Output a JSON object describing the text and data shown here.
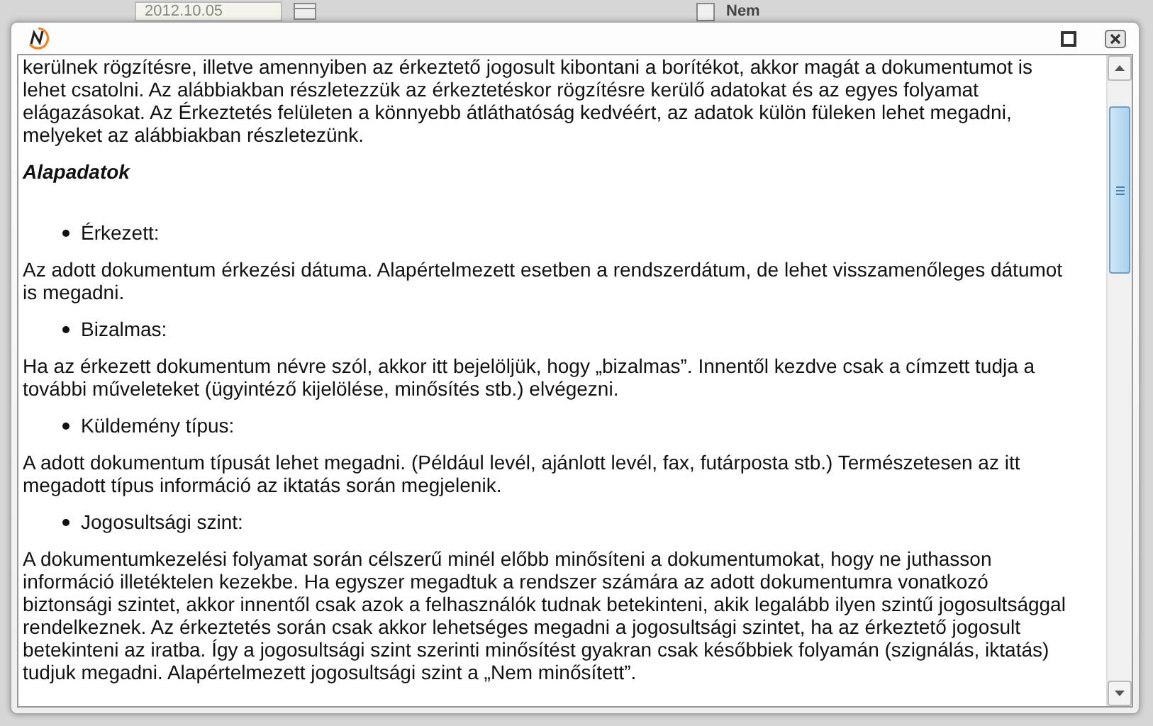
{
  "background": {
    "date_field": {
      "value": "2012.10.05"
    },
    "checkbox": {
      "label": "Nem",
      "checked": false
    }
  },
  "dialog": {
    "content": [
      {
        "kind": "paragraph",
        "text": "kerülnek rögzítésre, illetve amennyiben az érkeztető jogosult kibontani a borítékot, akkor magát a dokumentumot is lehet csatolni. Az alábbiakban részletezzük az érkeztetéskor rögzítésre kerülő adatokat és az egyes folyamat elágazásokat. Az Érkeztetés felületen a könnyebb átláthatóság kedvéért, az adatok külön füleken lehet megadni, melyeket az alábbiakban részletezünk."
      },
      {
        "kind": "heading",
        "text": "Alapadatok"
      },
      {
        "kind": "bullet",
        "text": "Érkezett:"
      },
      {
        "kind": "paragraph",
        "text": "Az adott dokumentum érkezési dátuma. Alapértelmezett esetben a rendszerdátum, de lehet visszamenőleges dátumot is megadni."
      },
      {
        "kind": "bullet",
        "text": "Bizalmas:"
      },
      {
        "kind": "paragraph",
        "text": "Ha az érkezett dokumentum névre szól, akkor itt bejelöljük, hogy „bizalmas”. Innentől kezdve csak a címzett tudja a további műveleteket (ügyintéző kijelölése, minősítés stb.) elvégezni."
      },
      {
        "kind": "bullet",
        "text": "Küldemény típus:"
      },
      {
        "kind": "paragraph",
        "text": "A adott dokumentum típusát lehet megadni. (Például levél, ajánlott levél, fax, futárposta stb.) Természetesen az itt megadott típus információ az iktatás során megjelenik."
      },
      {
        "kind": "bullet",
        "text": "Jogosultsági szint:"
      },
      {
        "kind": "paragraph",
        "text": "A dokumentumkezelési folyamat során célszerű minél előbb minősíteni a dokumentumokat, hogy ne juthasson információ illetéktelen kezekbe. Ha egyszer megadtuk a rendszer számára az adott dokumentumra vonatkozó biztonsági szintet, akkor innentől csak azok a felhasználók tudnak betekinteni, akik legalább ilyen szintű jogosultsággal rendelkeznek. Az érkeztetés során csak akkor lehetséges megadni a jogosultsági szintet, ha az érkeztető jogosult betekinteni az iratba. Így a jogosultsági szint szerinti minősítést gyakran csak későbbiek folyamán (szignálás, iktatás) tudjuk megadni. Alapértelmezett jogosultsági szint a „Nem minősített”."
      }
    ]
  }
}
